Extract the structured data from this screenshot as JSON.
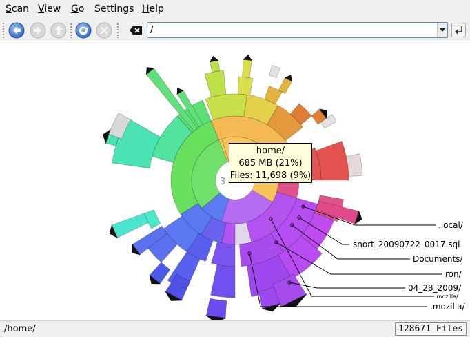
{
  "menu": {
    "scan_acc": "S",
    "scan_rest": "can",
    "view_acc": "V",
    "view_rest": "iew",
    "go_acc": "G",
    "go_rest": "o",
    "settings": "Settings",
    "help_acc": "H",
    "help_rest": "elp"
  },
  "toolbar": {
    "back_icon": "back-arrow-icon",
    "forward_icon": "forward-arrow-icon",
    "up_icon": "up-arrow-icon",
    "reload_icon": "reload-icon",
    "stop_icon": "stop-icon",
    "clear_icon": "clear-location-icon",
    "go_icon": "enter-icon"
  },
  "location": {
    "value": "/"
  },
  "chart": {
    "center_label": "3",
    "leaders": [
      {
        "label": ".local/",
        "small": false
      },
      {
        "label": "snort_20090722_0017.sql",
        "small": false
      },
      {
        "label": "Documents/",
        "small": false
      },
      {
        "label": "ron/",
        "small": false
      },
      {
        "label": "04_28_2009/",
        "small": false
      },
      {
        "label": ".mozilla/",
        "small": true
      },
      {
        "label": ".mozilla/",
        "small": false
      }
    ]
  },
  "tooltip": {
    "name": "home/",
    "size": "685 MB (21%)",
    "files": "Files: 11,698 (9%)"
  },
  "status": {
    "path": "/home/",
    "count": "128671 Files"
  },
  "colors": {
    "chrome": "#efefef",
    "accent": "#5a86c8",
    "tooltip_bg": "#ffffdc"
  }
}
